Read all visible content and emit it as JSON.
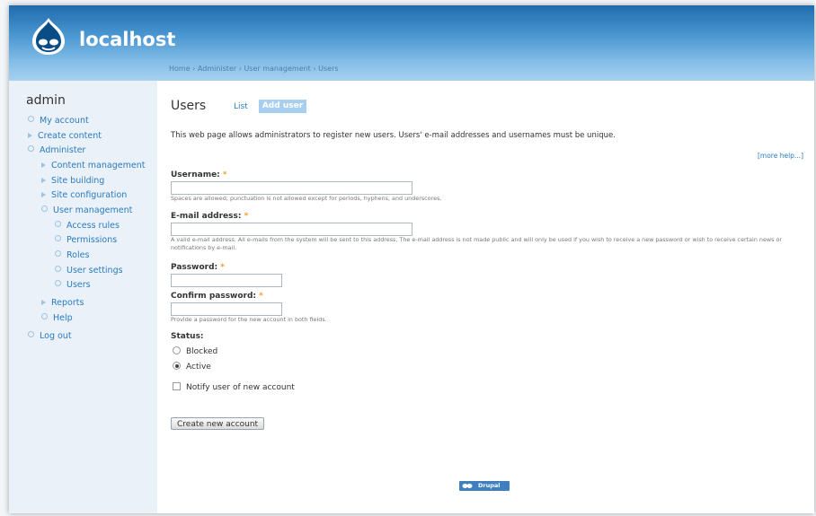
{
  "site": {
    "name": "localhost"
  },
  "breadcrumb": {
    "items": [
      "Home",
      "Administer",
      "User management",
      "Users"
    ],
    "separator": "›"
  },
  "sidebar": {
    "title": "admin",
    "items": [
      {
        "label": "My account"
      },
      {
        "label": "Create content"
      },
      {
        "label": "Administer"
      },
      {
        "label": "Content management"
      },
      {
        "label": "Site building"
      },
      {
        "label": "Site configuration"
      },
      {
        "label": "User management"
      },
      {
        "label": "Access rules"
      },
      {
        "label": "Permissions"
      },
      {
        "label": "Roles"
      },
      {
        "label": "User settings"
      },
      {
        "label": "Users"
      },
      {
        "label": "Reports"
      },
      {
        "label": "Help"
      },
      {
        "label": "Log out"
      }
    ]
  },
  "main": {
    "title": "Users",
    "tabs": [
      {
        "label": "List"
      },
      {
        "label": "Add user",
        "active": true
      }
    ],
    "intro": "This web page allows administrators to register new users. Users' e-mail addresses and usernames must be unique.",
    "more_help": "[more help...]",
    "form": {
      "required_marker": "*",
      "username": {
        "label": "Username:",
        "value": "",
        "description": "Spaces are allowed; punctuation is not allowed except for periods, hyphens, and underscores."
      },
      "email": {
        "label": "E-mail address:",
        "value": "",
        "description": "A valid e-mail address. All e-mails from the system will be sent to this address. The e-mail address is not made public and will only be used if you wish to receive a new password or wish to receive certain news or notifications by e-mail."
      },
      "password": {
        "label": "Password:",
        "value": ""
      },
      "confirm_password": {
        "label": "Confirm password:",
        "value": "",
        "description": "Provide a password for the new account in both fields."
      },
      "status": {
        "label": "Status:",
        "options": [
          "Blocked",
          "Active"
        ],
        "selected": "Active"
      },
      "notify": {
        "label": "Notify user of new account",
        "checked": false
      },
      "submit_label": "Create new account"
    },
    "powered_by": "Drupal"
  },
  "colors": {
    "header": "#1f6bad",
    "link": "#2a7bbf",
    "required": "#f0a030",
    "tab_active": "#a8cff0"
  }
}
